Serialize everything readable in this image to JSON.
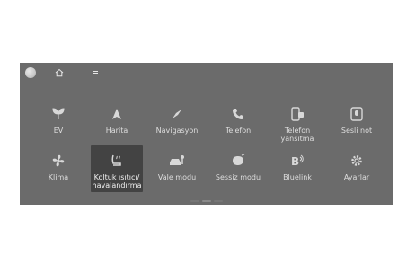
{
  "apps_row1": [
    {
      "name": "ev",
      "label": "EV",
      "icon": "leaf-icon"
    },
    {
      "name": "harita",
      "label": "Harita",
      "icon": "arrow-up-icon"
    },
    {
      "name": "navigasyon",
      "label": "Navigasyon",
      "icon": "compass-icon"
    },
    {
      "name": "telefon",
      "label": "Telefon",
      "icon": "phone-icon"
    },
    {
      "name": "telefon-yansitma",
      "label": "Telefon\nyansıtma",
      "icon": "phone-projection-icon"
    },
    {
      "name": "sesli-not",
      "label": "Sesli not",
      "icon": "voice-memo-icon"
    }
  ],
  "apps_row2": [
    {
      "name": "klima",
      "label": "Klima",
      "icon": "fan-icon"
    },
    {
      "name": "koltuk",
      "label": "Koltuk ısıtıcı/\nhavalandırma",
      "icon": "seat-heat-icon",
      "selected": true
    },
    {
      "name": "vale-modu",
      "label": "Vale modu",
      "icon": "valet-icon"
    },
    {
      "name": "sessiz-modu",
      "label": "Sessiz modu",
      "icon": "quiet-mode-icon"
    },
    {
      "name": "bluelink",
      "label": "Bluelink",
      "icon": "bluelink-icon"
    },
    {
      "name": "ayarlar",
      "label": "Ayarlar",
      "icon": "gear-icon"
    }
  ],
  "colors": {
    "screen_bg": "#6b6b6b",
    "selected_bg": "#434343",
    "label": "#dedede"
  }
}
